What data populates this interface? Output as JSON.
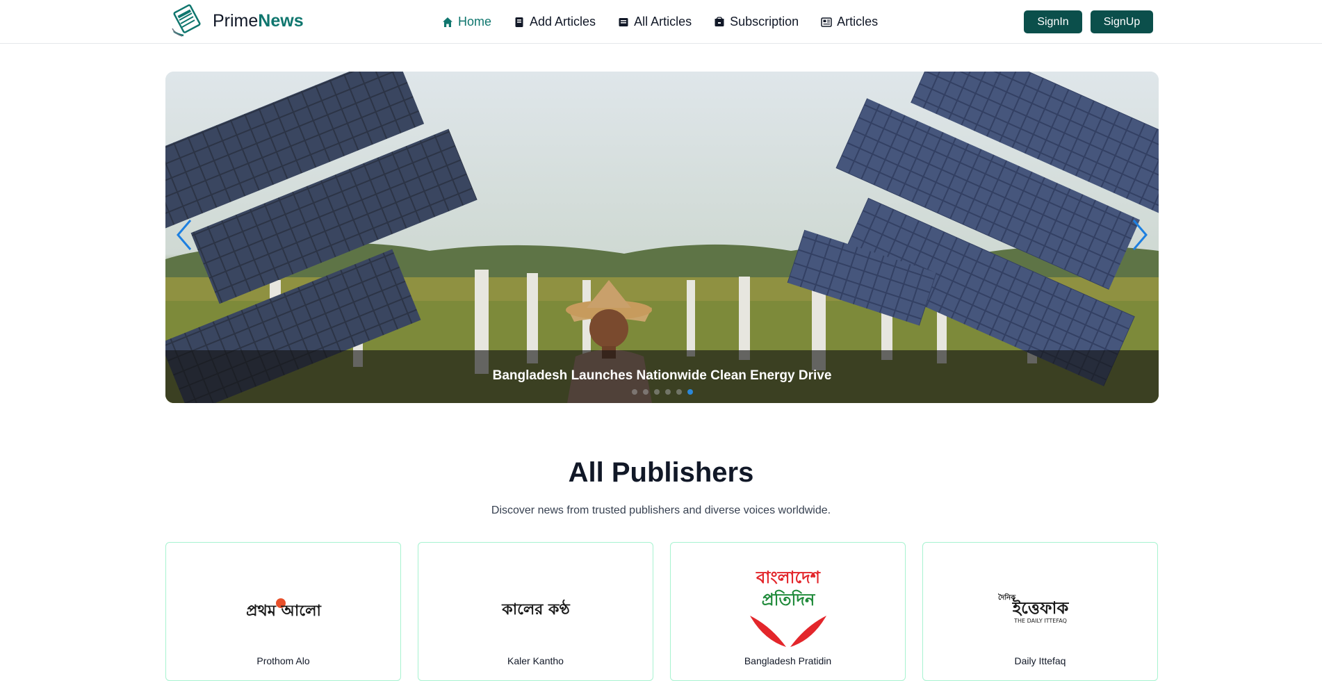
{
  "brand": {
    "prefix": "Prime",
    "accent": "News"
  },
  "nav": {
    "home": "Home",
    "add_articles": "Add Articles",
    "all_articles": "All Articles",
    "subscription": "Subscription",
    "articles": "Articles"
  },
  "auth": {
    "signin": "SignIn",
    "signup": "SignUp"
  },
  "hero": {
    "caption": "Bangladesh Launches Nationwide Clean Energy Drive",
    "slide_count": 6,
    "active_slide": 5
  },
  "publishers": {
    "title": "All Publishers",
    "subtitle": "Discover news from trusted publishers and diverse voices worldwide.",
    "items": [
      {
        "logo_text": "প্রথম আলো",
        "name": "Prothom Alo"
      },
      {
        "logo_text": "কালের কণ্ঠ",
        "name": "Kaler Kantho"
      },
      {
        "logo_text_top": "বাংলাদেশ",
        "logo_text_bottom": "প্রতিদিন",
        "name": "Bangladesh Pratidin"
      },
      {
        "logo_text_small": "দৈনিক",
        "logo_text": "ইত্তেফাক",
        "logo_text_en": "THE DAILY ITTEFAQ",
        "name": "Daily Ittefaq"
      }
    ]
  },
  "colors": {
    "brand_teal": "#0f766e",
    "button_bg": "#0b4f4b",
    "card_border": "#a7f3d0",
    "dot_active": "#2b87d8"
  }
}
